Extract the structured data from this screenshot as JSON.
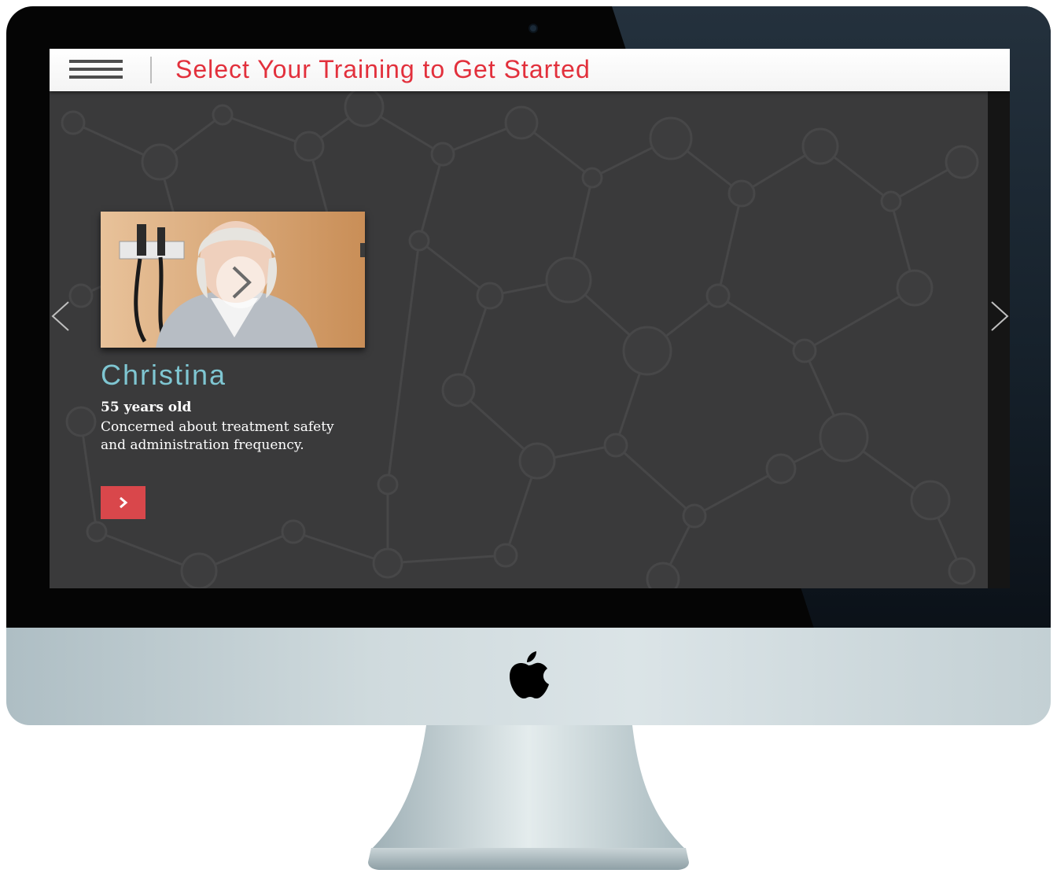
{
  "header": {
    "title": "Select Your Training to Get Started",
    "menu_icon": "hamburger-menu-icon"
  },
  "carousel": {
    "prev_icon": "chevron-left-icon",
    "next_icon": "chevron-right-icon",
    "cards": [
      {
        "name": "Christina",
        "age": "55 years old",
        "description": "Concerned about treatment safety and administration frequency.",
        "play_icon": "play-icon",
        "button_icon": "chevron-right-icon"
      }
    ]
  },
  "colors": {
    "accent_red": "#e2303c",
    "button_red": "#d9474b",
    "name_teal": "#7fc6d2",
    "screen_bg": "#3a3a3b"
  },
  "device": {
    "logo_icon": "apple-logo-icon"
  }
}
